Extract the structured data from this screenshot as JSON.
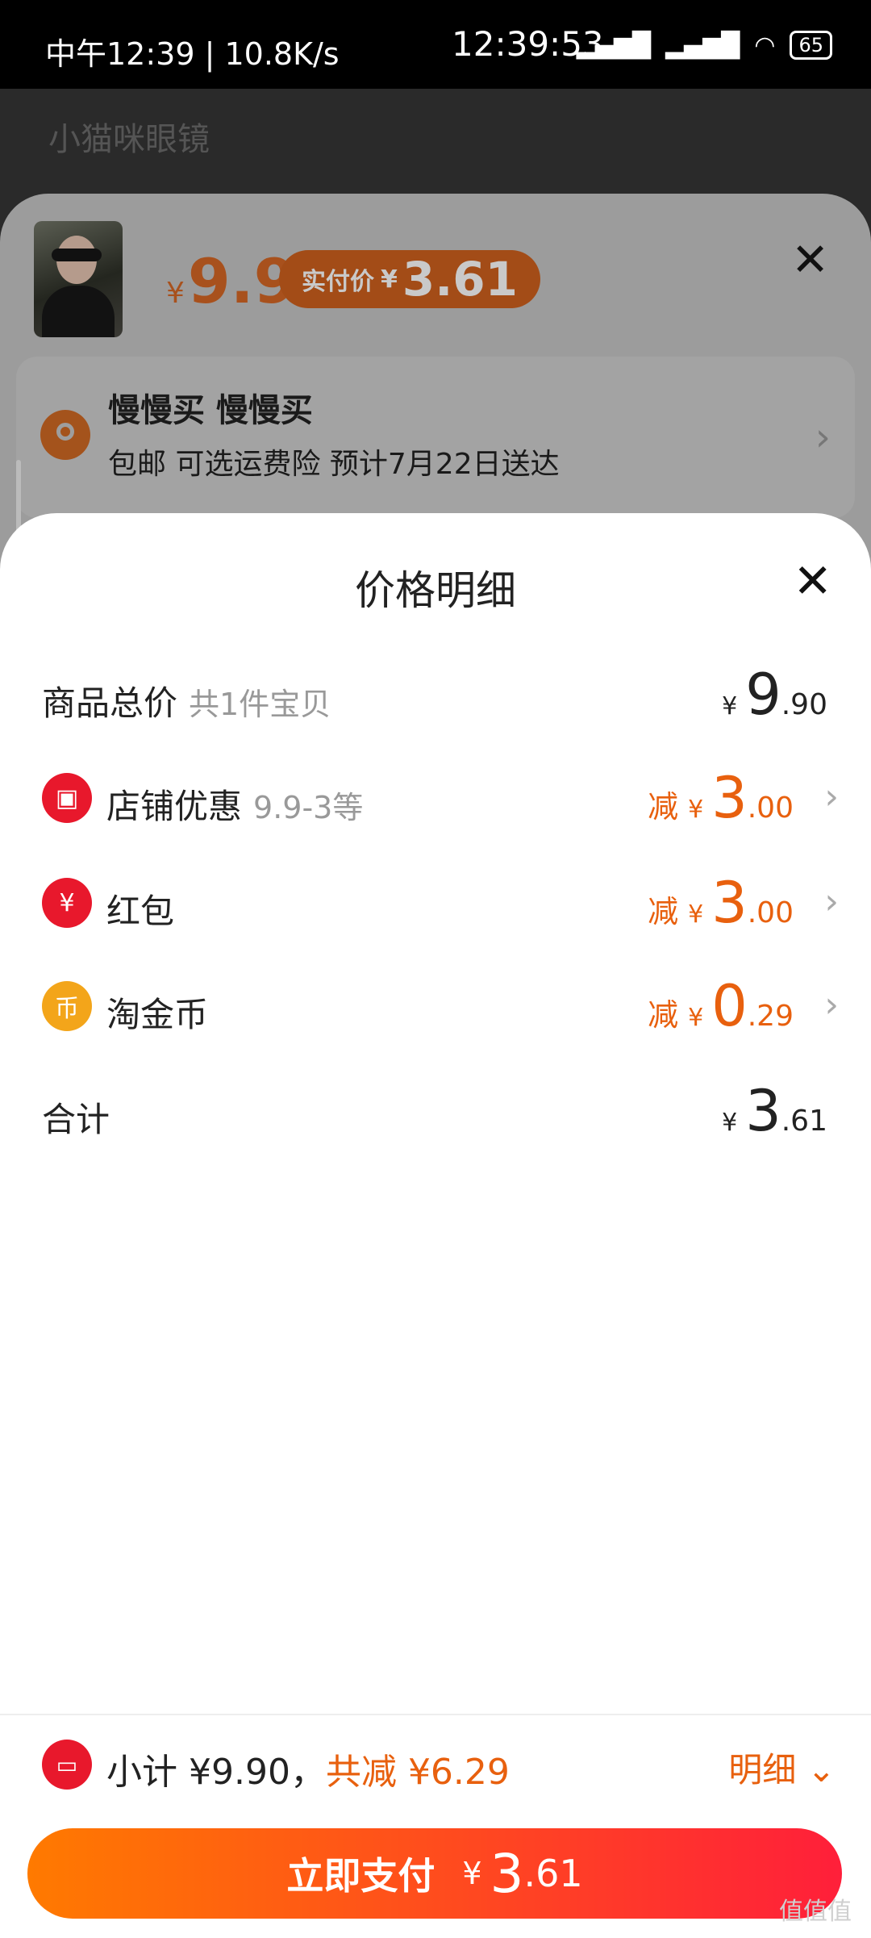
{
  "status_bar": {
    "left": "中午12:39 | 10.8K/s",
    "clock": "12:39:53",
    "battery": "65"
  },
  "background": {
    "search_text": "小猫咪眼镜"
  },
  "order": {
    "price_yen": "¥",
    "price": "9.9",
    "paid_label": "实付价",
    "paid_yen": "¥",
    "paid_value": "3.61",
    "address_name": "慢慢买 慢慢买",
    "address_sub": "包邮  可选运费险  预计7月22日送达"
  },
  "modal": {
    "title": "价格明细",
    "rows": [
      {
        "label": "商品总价",
        "sub": "共1件宝贝",
        "yen": "¥",
        "int": "9",
        "dec": ".90"
      },
      {
        "label": "店铺优惠",
        "sub": "9.9-3等",
        "prefix": "减",
        "yen": "¥",
        "int": "3",
        "dec": ".00",
        "icon": "shop-icon"
      },
      {
        "label": "红包",
        "sub": "",
        "prefix": "减",
        "yen": "¥",
        "int": "3",
        "dec": ".00",
        "icon": "red-packet-icon"
      },
      {
        "label": "淘金币",
        "sub": "",
        "prefix": "减",
        "yen": "¥",
        "int": "0",
        "dec": ".29",
        "icon": "gold-coin-icon"
      },
      {
        "label": "合计",
        "sub": "",
        "yen": "¥",
        "int": "3",
        "dec": ".61"
      }
    ]
  },
  "bottom": {
    "subtotal": "小计 ¥9.90，",
    "saving": "共减 ¥6.29",
    "detail": "明细",
    "pay_label": "立即支付",
    "pay_yen": "¥",
    "pay_int": "3",
    "pay_dec": ".61"
  },
  "watermark": "值值值"
}
